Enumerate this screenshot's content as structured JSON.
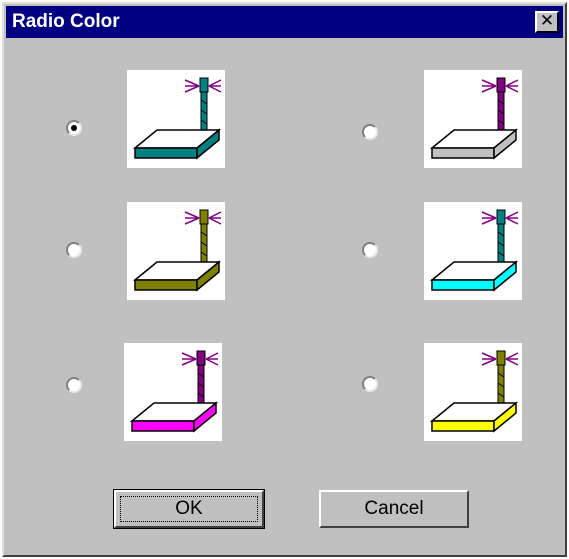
{
  "dialog": {
    "title": "Radio Color",
    "close_glyph": "✕"
  },
  "options": [
    {
      "selected": true,
      "icon": "radio-teal-icon",
      "body_color": "#ffffff",
      "stripe_color": "#008080",
      "antenna_color": "#008080"
    },
    {
      "selected": false,
      "icon": "radio-gray-icon",
      "body_color": "#ffffff",
      "stripe_color": "#c0c0c0",
      "antenna_color": "#800080"
    },
    {
      "selected": false,
      "icon": "radio-olive-icon",
      "body_color": "#ffffff",
      "stripe_color": "#808000",
      "antenna_color": "#808000"
    },
    {
      "selected": false,
      "icon": "radio-cyan-icon",
      "body_color": "#ffffff",
      "stripe_color": "#00ffff",
      "antenna_color": "#008080"
    },
    {
      "selected": false,
      "icon": "radio-magenta-icon",
      "body_color": "#ffffff",
      "stripe_color": "#ff00ff",
      "antenna_color": "#800080"
    },
    {
      "selected": false,
      "icon": "radio-yellow-icon",
      "body_color": "#ffffff",
      "stripe_color": "#ffff00",
      "antenna_color": "#808000"
    }
  ],
  "buttons": {
    "ok_label": "OK",
    "cancel_label": "Cancel"
  }
}
